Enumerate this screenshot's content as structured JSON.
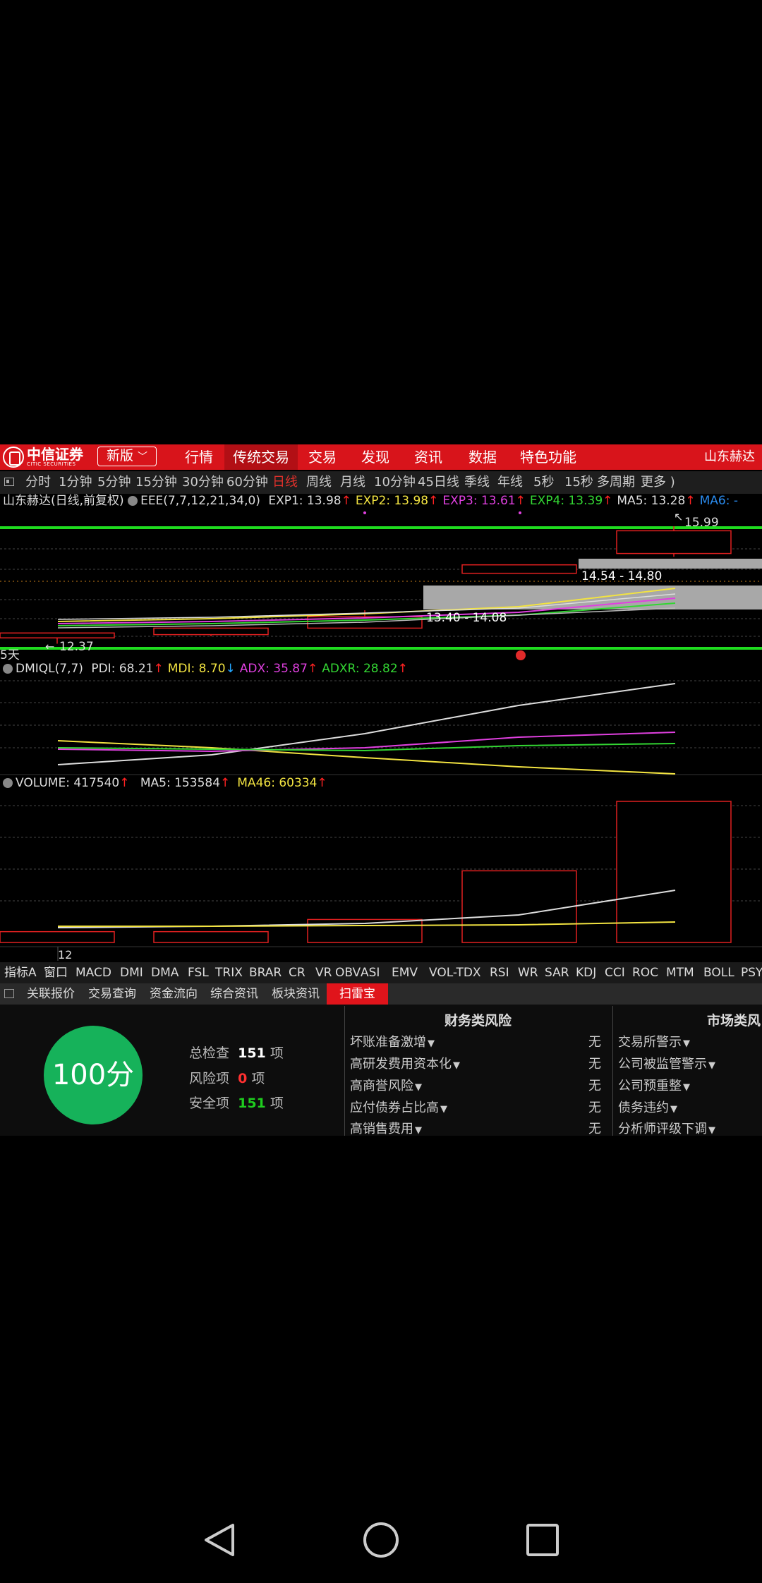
{
  "brand": {
    "name": "中信证券",
    "sub": "CITIC SECURITIES"
  },
  "header": {
    "version_btn": "新版",
    "menu": [
      "行情",
      "传统交易",
      "交易",
      "发现",
      "资讯",
      "数据",
      "特色功能"
    ],
    "active_menu": "传统交易",
    "stock_name": "山东赫达"
  },
  "periods": [
    "分时",
    "1分钟",
    "5分钟",
    "15分钟",
    "30分钟",
    "60分钟",
    "日线",
    "周线",
    "月线",
    "10分钟",
    "45日线",
    "季线",
    "年线",
    "5秒",
    "15秒",
    "多周期",
    "更多 )"
  ],
  "active_period": "日线",
  "price_panel": {
    "title": "山东赫达(日线,前复权)",
    "indicator": "EEE(7,7,12,21,34,0)",
    "items": [
      {
        "label": "EXP1: 13.98",
        "arrow": "↑",
        "color": "#dddddd"
      },
      {
        "label": "EXP2: 13.98",
        "arrow": "↑",
        "color": "#f2e341"
      },
      {
        "label": "EXP3: 13.61",
        "arrow": "↑",
        "color": "#e040e0"
      },
      {
        "label": "EXP4: 13.39",
        "arrow": "↑",
        "color": "#33d633"
      },
      {
        "label": "MA5: 13.28",
        "arrow": "↑",
        "color": "#dddddd"
      },
      {
        "label": "MA6: -",
        "arrow": "",
        "color": "#2a8cf0"
      }
    ],
    "high_label": "15.99",
    "low_label": "12.37",
    "range1": "14.54 - 14.80",
    "range2": "13.40 - 14.08",
    "days_label": "5天",
    "candles": [
      {
        "open": 12.55,
        "close": 12.7,
        "high": 12.7,
        "low": 12.37
      },
      {
        "open": 12.65,
        "close": 12.85,
        "high": 12.85,
        "low": 12.6
      },
      {
        "open": 12.85,
        "close": 13.2,
        "high": 13.4,
        "low": 12.85
      },
      {
        "open": 14.54,
        "close": 14.8,
        "high": 14.8,
        "low": 14.54
      },
      {
        "open": 15.15,
        "close": 15.85,
        "high": 15.99,
        "low": 15.05
      }
    ],
    "ylim": [
      12.25,
      16.25
    ]
  },
  "dmi_panel": {
    "title": "DMIQL(7,7)",
    "items": [
      {
        "label": "PDI: 68.21",
        "arrow": "↑",
        "color": "#dddddd",
        "dir": "up"
      },
      {
        "label": "MDI: 8.70",
        "arrow": "↓",
        "color": "#f2e341",
        "dir": "down"
      },
      {
        "label": "ADX: 35.87",
        "arrow": "↑",
        "color": "#e040e0",
        "dir": "up"
      },
      {
        "label": "ADXR: 28.82",
        "arrow": "↑",
        "color": "#33d633",
        "dir": "up"
      }
    ]
  },
  "volume_panel": {
    "title": "VOLUME: 417540",
    "title_arrow": "↑",
    "items": [
      {
        "label": "MA5: 153584",
        "arrow": "↑",
        "color": "#dddddd"
      },
      {
        "label": "MA46: 60334",
        "arrow": "↑",
        "color": "#f2e341"
      }
    ],
    "x_label": "12",
    "volumes": [
      32000,
      32000,
      68000,
      212000,
      417540
    ],
    "ylim": [
      0,
      430000
    ]
  },
  "indicator_tabs": [
    "指标A",
    "窗口",
    "MACD",
    "DMI",
    "DMA",
    "FSL",
    "TRIX",
    "BRAR",
    "CR",
    "VR",
    "OBV",
    "ASI",
    "EMV",
    "VOL-TDX",
    "RSI",
    "WR",
    "SAR",
    "KDJ",
    "CCI",
    "ROC",
    "MTM",
    "BOLL",
    "PSY"
  ],
  "info_tabs": [
    "关联报价",
    "交易查询",
    "资金流向",
    "综合资讯",
    "板块资讯",
    "扫雷宝"
  ],
  "active_info_tab": "扫雷宝",
  "scan": {
    "score": "100分",
    "total_label": "总检查",
    "total": "151",
    "unit": "项",
    "risk_label": "风险项",
    "risk": "0",
    "safe_label": "安全项",
    "safe": "151"
  },
  "financial_risk": {
    "title": "财务类风险",
    "items": [
      {
        "name": "坏账准备激增",
        "value": "无"
      },
      {
        "name": "高研发费用资本化",
        "value": "无"
      },
      {
        "name": "高商誉风险",
        "value": "无"
      },
      {
        "name": "应付债券占比高",
        "value": "无"
      },
      {
        "name": "高销售费用",
        "value": "无"
      }
    ]
  },
  "market_risk": {
    "title": "市场类风",
    "items": [
      "交易所警示",
      "公司被监管警示",
      "公司预重整",
      "债务违约",
      "分析师评级下调"
    ]
  }
}
